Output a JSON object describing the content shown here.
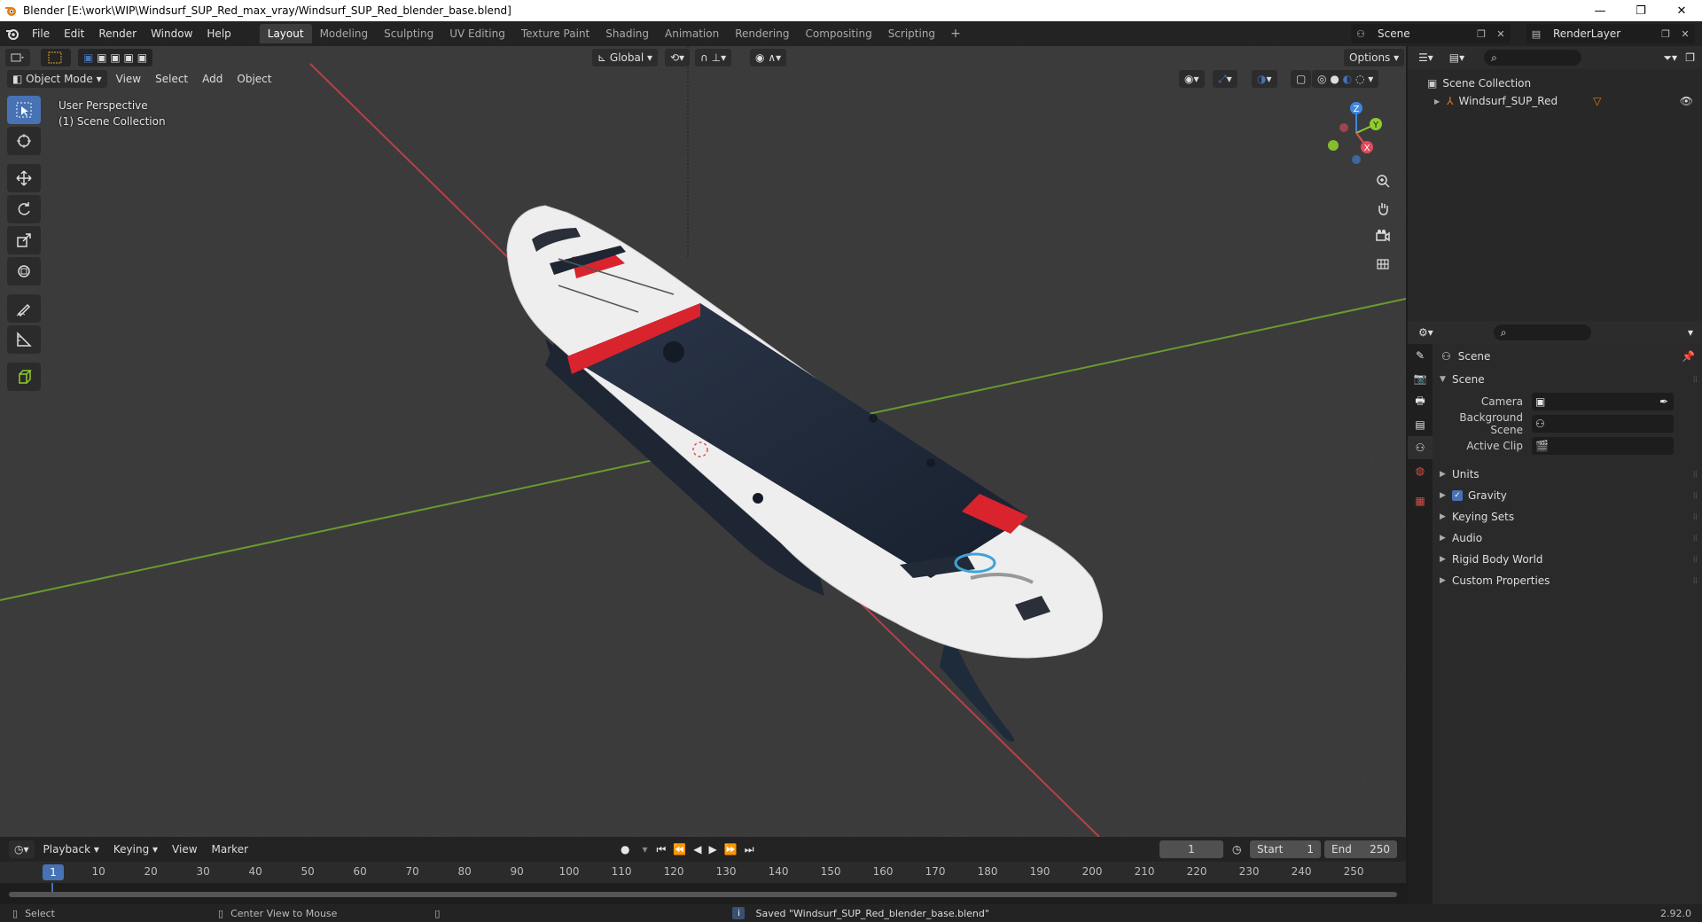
{
  "window": {
    "title": "Blender [E:\\work\\WIP\\Windsurf_SUP_Red_max_vray/Windsurf_SUP_Red_blender_base.blend]",
    "minimize": "—",
    "restore": "❐",
    "close": "✕"
  },
  "menu": [
    "File",
    "Edit",
    "Render",
    "Window",
    "Help"
  ],
  "workspaces": [
    "Layout",
    "Modeling",
    "Sculpting",
    "UV Editing",
    "Texture Paint",
    "Shading",
    "Animation",
    "Rendering",
    "Compositing",
    "Scripting"
  ],
  "workspace_add": "+",
  "scene_selector": "Scene",
  "layer_selector": "RenderLayer",
  "viewport": {
    "mode": "Object Mode",
    "menus": [
      "View",
      "Select",
      "Add",
      "Object"
    ],
    "orientation": "Global",
    "options": "Options",
    "info_line1": "User Perspective",
    "info_line2": "(1) Scene Collection"
  },
  "gizmo": {
    "x": "X",
    "y": "Y",
    "z": "Z"
  },
  "timeline": {
    "menus": [
      "Playback",
      "Keying",
      "View",
      "Marker"
    ],
    "current_frame": "1",
    "start_label": "Start",
    "start": "1",
    "end_label": "End",
    "end": "250",
    "ruler": [
      "10",
      "20",
      "30",
      "40",
      "50",
      "60",
      "70",
      "80",
      "90",
      "100",
      "110",
      "120",
      "130",
      "140",
      "150",
      "160",
      "170",
      "180",
      "190",
      "200",
      "210",
      "220",
      "230",
      "240",
      "250"
    ],
    "cursor_frame": "1"
  },
  "outliner": {
    "root": "Scene Collection",
    "item": "Windsurf_SUP_Red"
  },
  "properties": {
    "context": "Scene",
    "panel": "Scene",
    "camera_label": "Camera",
    "bg_scene_label": "Background Scene",
    "active_clip_label": "Active Clip",
    "panels": [
      "Units",
      "Gravity",
      "Keying Sets",
      "Audio",
      "Rigid Body World",
      "Custom Properties"
    ]
  },
  "status": {
    "select": "Select",
    "center_view": "Center View to Mouse",
    "saved_msg": "Saved \"Windsurf_SUP_Red_blender_base.blend\"",
    "version": "2.92.0"
  },
  "colors": {
    "accent": "#4772b3",
    "axis_x": "#e24a5a",
    "axis_y": "#8fcc2c",
    "axis_z": "#3f86e0",
    "board_red": "#d9242d",
    "board_navy": "#1f2a3c"
  }
}
